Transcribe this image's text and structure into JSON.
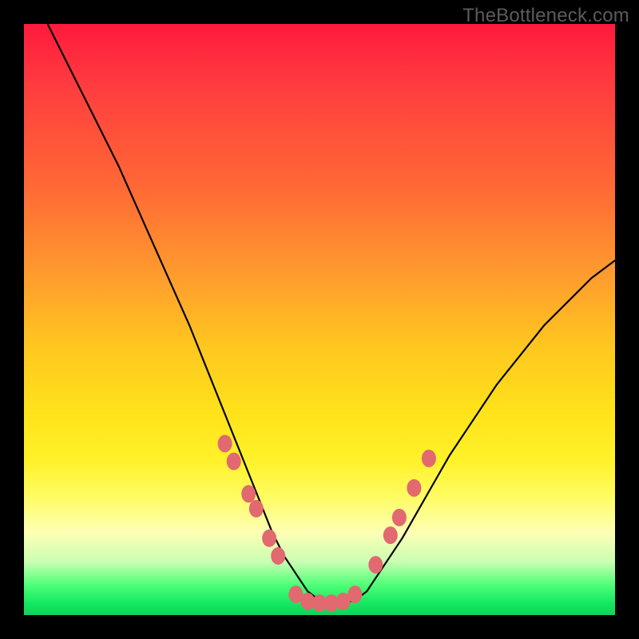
{
  "watermark": "TheBottleneck.com",
  "gradient_colors": {
    "top": "#ff1a3d",
    "upper_mid": "#ff9a2e",
    "mid": "#ffe31a",
    "lower_mid": "#fdffb5",
    "bottom": "#14e861"
  },
  "marker_color": "#e1696f",
  "curve_color": "#000000",
  "chart_data": {
    "type": "line",
    "title": "",
    "xlabel": "",
    "ylabel": "",
    "xlim": [
      0,
      100
    ],
    "ylim": [
      0,
      100
    ],
    "grid": false,
    "legend": null,
    "note": "Values estimated from pixel positions; x is horizontal %, y is vertical % from bottom (higher = nearer top).",
    "series": [
      {
        "name": "curve",
        "x": [
          4,
          8,
          12,
          16,
          20,
          24,
          28,
          30,
          32,
          34,
          36,
          38,
          40,
          42,
          44,
          46,
          48,
          50,
          52,
          54,
          56,
          58,
          60,
          64,
          68,
          72,
          76,
          80,
          84,
          88,
          92,
          96,
          100
        ],
        "y": [
          100,
          92,
          84,
          76,
          67,
          58,
          49,
          44,
          39,
          34,
          29,
          24,
          19,
          14,
          10,
          7,
          4,
          2.5,
          2,
          2,
          2.5,
          4,
          7,
          13,
          20,
          27,
          33,
          39,
          44,
          49,
          53,
          57,
          60
        ]
      }
    ],
    "markers": {
      "name": "dots",
      "points": [
        {
          "x": 34.0,
          "y": 29.0
        },
        {
          "x": 35.5,
          "y": 26.0
        },
        {
          "x": 38.0,
          "y": 20.5
        },
        {
          "x": 39.3,
          "y": 18.0
        },
        {
          "x": 41.5,
          "y": 13.0
        },
        {
          "x": 43.0,
          "y": 10.0
        },
        {
          "x": 46.0,
          "y": 3.5
        },
        {
          "x": 48.0,
          "y": 2.3
        },
        {
          "x": 50.0,
          "y": 2.0
        },
        {
          "x": 52.0,
          "y": 2.0
        },
        {
          "x": 54.0,
          "y": 2.3
        },
        {
          "x": 56.0,
          "y": 3.5
        },
        {
          "x": 59.5,
          "y": 8.5
        },
        {
          "x": 62.0,
          "y": 13.5
        },
        {
          "x": 63.5,
          "y": 16.5
        },
        {
          "x": 66.0,
          "y": 21.5
        },
        {
          "x": 68.5,
          "y": 26.5
        }
      ]
    }
  }
}
